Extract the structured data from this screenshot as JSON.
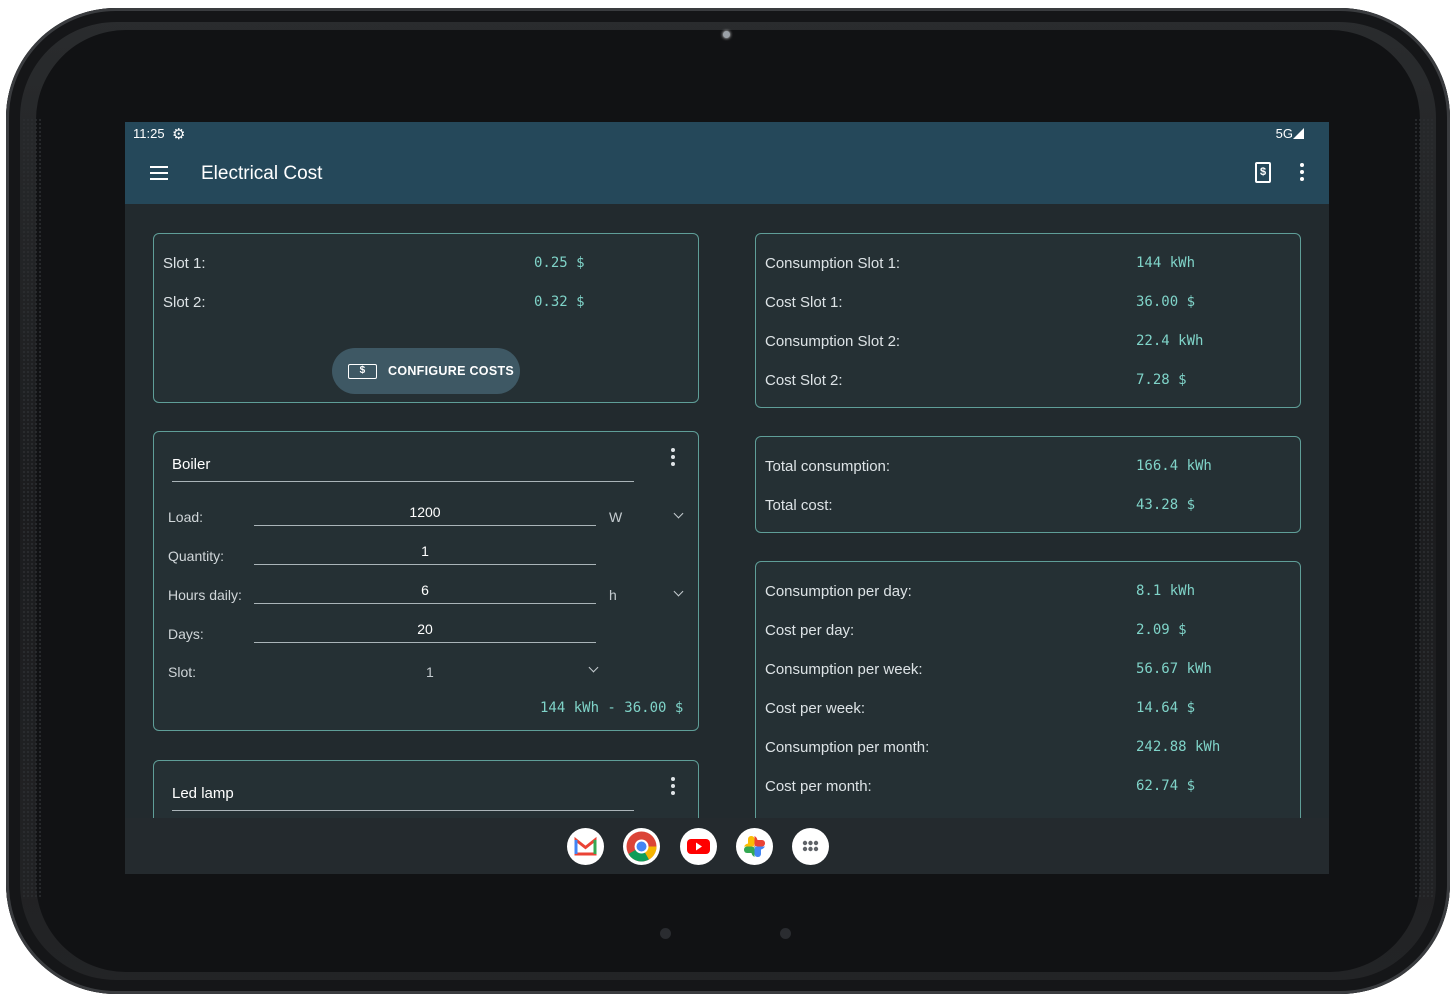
{
  "status": {
    "time": "11:25",
    "network": "5G"
  },
  "app": {
    "title": "Electrical Cost"
  },
  "rates": {
    "slot1_label": "Slot 1:",
    "slot1_value": "0.25 $",
    "slot2_label": "Slot 2:",
    "slot2_value": "0.32 $",
    "configure_label": "CONFIGURE COSTS",
    "cash_icon_text": "$"
  },
  "boiler": {
    "name": "Boiler",
    "load_label": "Load:",
    "load_value": "1200",
    "load_unit": "W",
    "quantity_label": "Quantity:",
    "quantity_value": "1",
    "hours_label": "Hours daily:",
    "hours_value": "6",
    "hours_unit": "h",
    "days_label": "Days:",
    "days_value": "20",
    "slot_label": "Slot:",
    "slot_value": "1",
    "summary": "144 kWh - 36.00 $"
  },
  "led": {
    "name": "Led lamp"
  },
  "slot_summary": {
    "rows": [
      {
        "label": "Consumption Slot 1:",
        "value": "144 kWh"
      },
      {
        "label": "Cost Slot 1:",
        "value": "36.00 $"
      },
      {
        "label": "Consumption Slot 2:",
        "value": "22.4 kWh"
      },
      {
        "label": "Cost Slot 2:",
        "value": "7.28 $"
      }
    ]
  },
  "totals": {
    "rows": [
      {
        "label": "Total consumption:",
        "value": "166.4 kWh"
      },
      {
        "label": "Total cost:",
        "value": "43.28 $"
      }
    ]
  },
  "periods": {
    "rows": [
      {
        "label": "Consumption per day:",
        "value": "8.1 kWh"
      },
      {
        "label": "Cost per day:",
        "value": "2.09 $"
      },
      {
        "label": "Consumption per week:",
        "value": "56.67 kWh"
      },
      {
        "label": "Cost per week:",
        "value": "14.64 $"
      },
      {
        "label": "Consumption per month:",
        "value": "242.88 kWh"
      },
      {
        "label": "Cost per month:",
        "value": "62.74 $"
      }
    ]
  },
  "dock": {
    "apps": [
      {
        "name": "gmail-icon",
        "color": "#ea4335"
      },
      {
        "name": "chrome-icon",
        "color": "#4285f4"
      },
      {
        "name": "youtube-icon",
        "color": "#ff0000"
      },
      {
        "name": "photos-icon",
        "color": "#fbbc04"
      },
      {
        "name": "app-drawer-icon",
        "color": "#5f6368"
      }
    ]
  }
}
